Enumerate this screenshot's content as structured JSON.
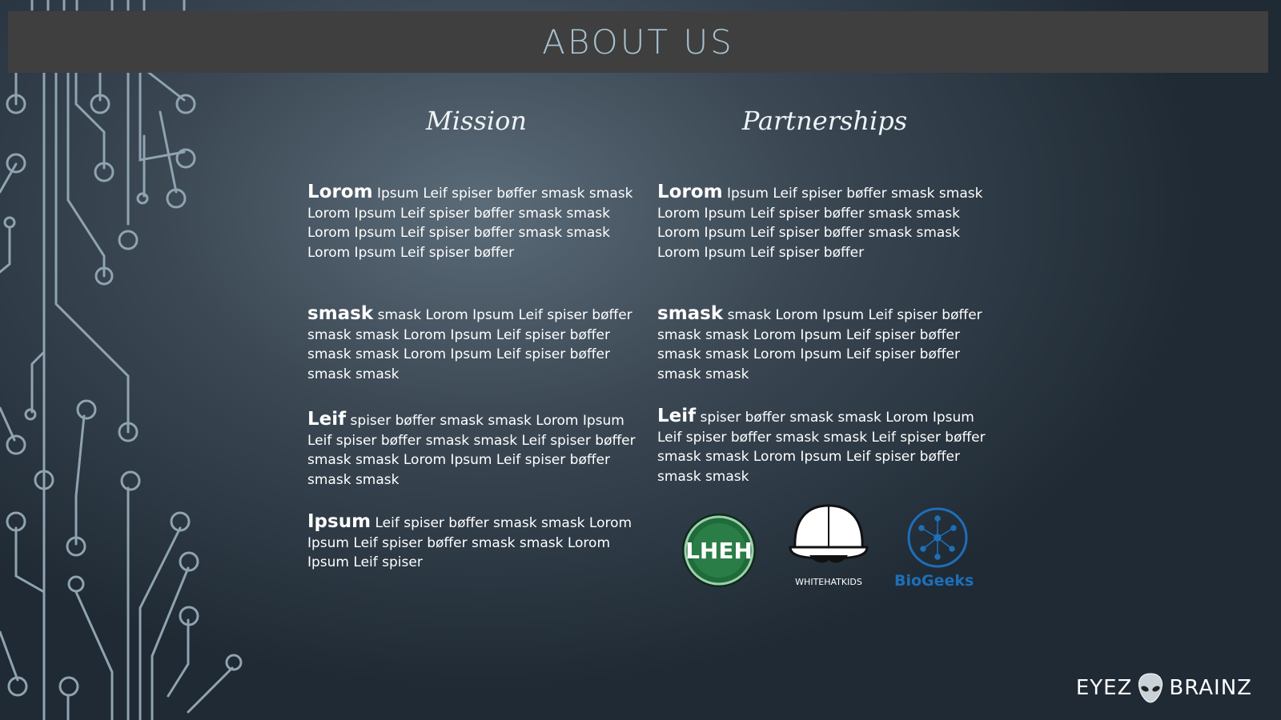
{
  "title": "ABOUT US",
  "mission": {
    "heading": "Mission",
    "paragraphs": [
      {
        "lead": "Lorom",
        "text": " Ipsum Leif spiser bøffer smask smask Lorom Ipsum Leif spiser bøffer smask smask Lorom Ipsum Leif spiser bøffer smask smask Lorom Ipsum Leif spiser bøffer"
      },
      {
        "lead": "smask",
        "text": " smask Lorom Ipsum Leif spiser bøffer smask smask Lorom Ipsum Leif spiser bøffer smask smask Lorom Ipsum Leif spiser bøffer smask smask"
      },
      {
        "lead": "Leif",
        "text": " spiser bøffer smask smask Lorom Ipsum Leif spiser bøffer smask smask Leif spiser bøffer smask smask Lorom Ipsum Leif spiser bøffer smask smask"
      },
      {
        "lead": "Ipsum",
        "text": " Leif spiser bøffer smask smask Lorom Ipsum Leif spiser bøffer smask smask Lorom Ipsum Leif spiser"
      }
    ]
  },
  "partnerships": {
    "heading": "Partnerships",
    "paragraphs": [
      {
        "lead": "Lorom",
        "text": " Ipsum Leif spiser bøffer smask smask Lorom Ipsum Leif spiser bøffer smask smask Lorom Ipsum Leif spiser bøffer smask smask Lorom Ipsum Leif spiser bøffer"
      },
      {
        "lead": "smask",
        "text": " smask Lorom Ipsum Leif spiser bøffer smask smask Lorom Ipsum Leif spiser bøffer smask smask Lorom Ipsum Leif spiser bøffer smask smask"
      },
      {
        "lead": "Leif",
        "text": " spiser bøffer smask smask Lorom Ipsum Leif spiser bøffer smask smask Leif spiser bøffer smask smask Lorom Ipsum Leif spiser bøffer smask smask"
      }
    ],
    "logos": {
      "lheh": "LHEH",
      "whitehatkids": "WHITEHATKIDS",
      "biogeeks": "BioGeeks"
    }
  },
  "footer": {
    "brand_left": "EYEZ",
    "brand_right": "BRAINZ"
  },
  "colors": {
    "title_bar": "#3f3f3f",
    "title_text": "#a8c0cf",
    "lheh_green": "#1f6b3a",
    "biogeeks_blue": "#1e6fb8"
  }
}
